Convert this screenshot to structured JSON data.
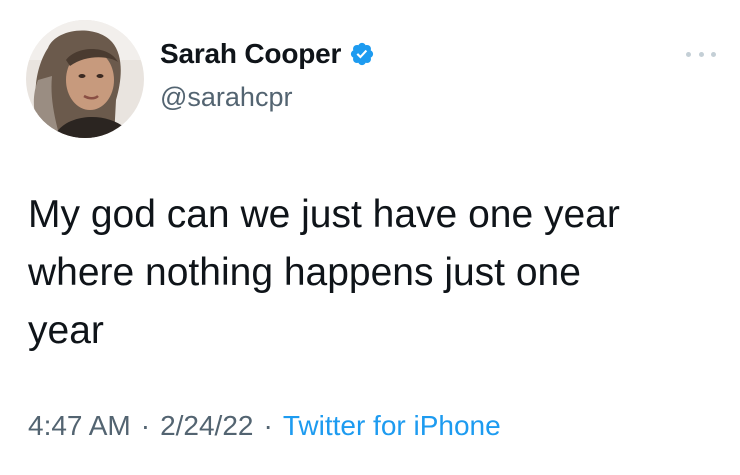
{
  "tweet": {
    "author": {
      "display_name": "Sarah Cooper",
      "handle": "@sarahcpr",
      "verified": true
    },
    "text": "My god can we just have one year\nwhere nothing happens just one\nyear",
    "time": "4:47 AM",
    "date": "2/24/22",
    "source": "Twitter for iPhone",
    "separator": "·"
  },
  "icons": {
    "verified": "verified-badge-icon",
    "more": "more-options-icon"
  },
  "colors": {
    "text_primary": "#0f1419",
    "text_secondary": "#536471",
    "accent": "#1d9bf0",
    "background": "#ffffff"
  }
}
